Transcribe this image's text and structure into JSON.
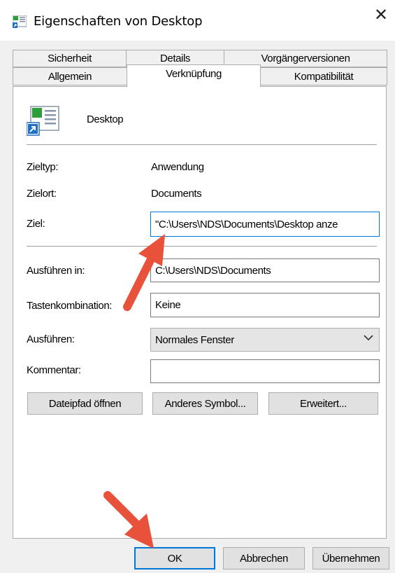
{
  "window": {
    "title": "Eigenschaften von Desktop",
    "close_glyph": "✕"
  },
  "tabs": {
    "row1": [
      "Sicherheit",
      "Details",
      "Vorgängerversionen"
    ],
    "row2": [
      "Allgemein",
      "Verknüpfung",
      "Kompatibilität"
    ],
    "active": "Verknüpfung"
  },
  "shortcut": {
    "name": "Desktop",
    "icon": "desktop-shortcut-icon",
    "target_type_label": "Zieltyp:",
    "target_type_value": "Anwendung",
    "target_location_label": "Zielort:",
    "target_location_value": "Documents",
    "target_label": "Ziel:",
    "target_value": "\"C:\\Users\\NDS\\Documents\\Desktop anze",
    "start_in_label": "Ausführen in:",
    "start_in_value": "C:\\Users\\NDS\\Documents",
    "hotkey_label": "Tastenkombination:",
    "hotkey_value": "Keine",
    "run_label": "Ausführen:",
    "run_value": "Normales Fenster",
    "comment_label": "Kommentar:",
    "comment_value": ""
  },
  "buttons": {
    "open_location": "Dateipfad öffnen",
    "change_icon": "Anderes Symbol...",
    "advanced": "Erweitert...",
    "ok": "OK",
    "cancel": "Abbrechen",
    "apply": "Übernehmen"
  },
  "colors": {
    "accent": "#0078d7",
    "annotation_arrow": "#e8513a",
    "dialog_bg": "#f0f0f0"
  }
}
